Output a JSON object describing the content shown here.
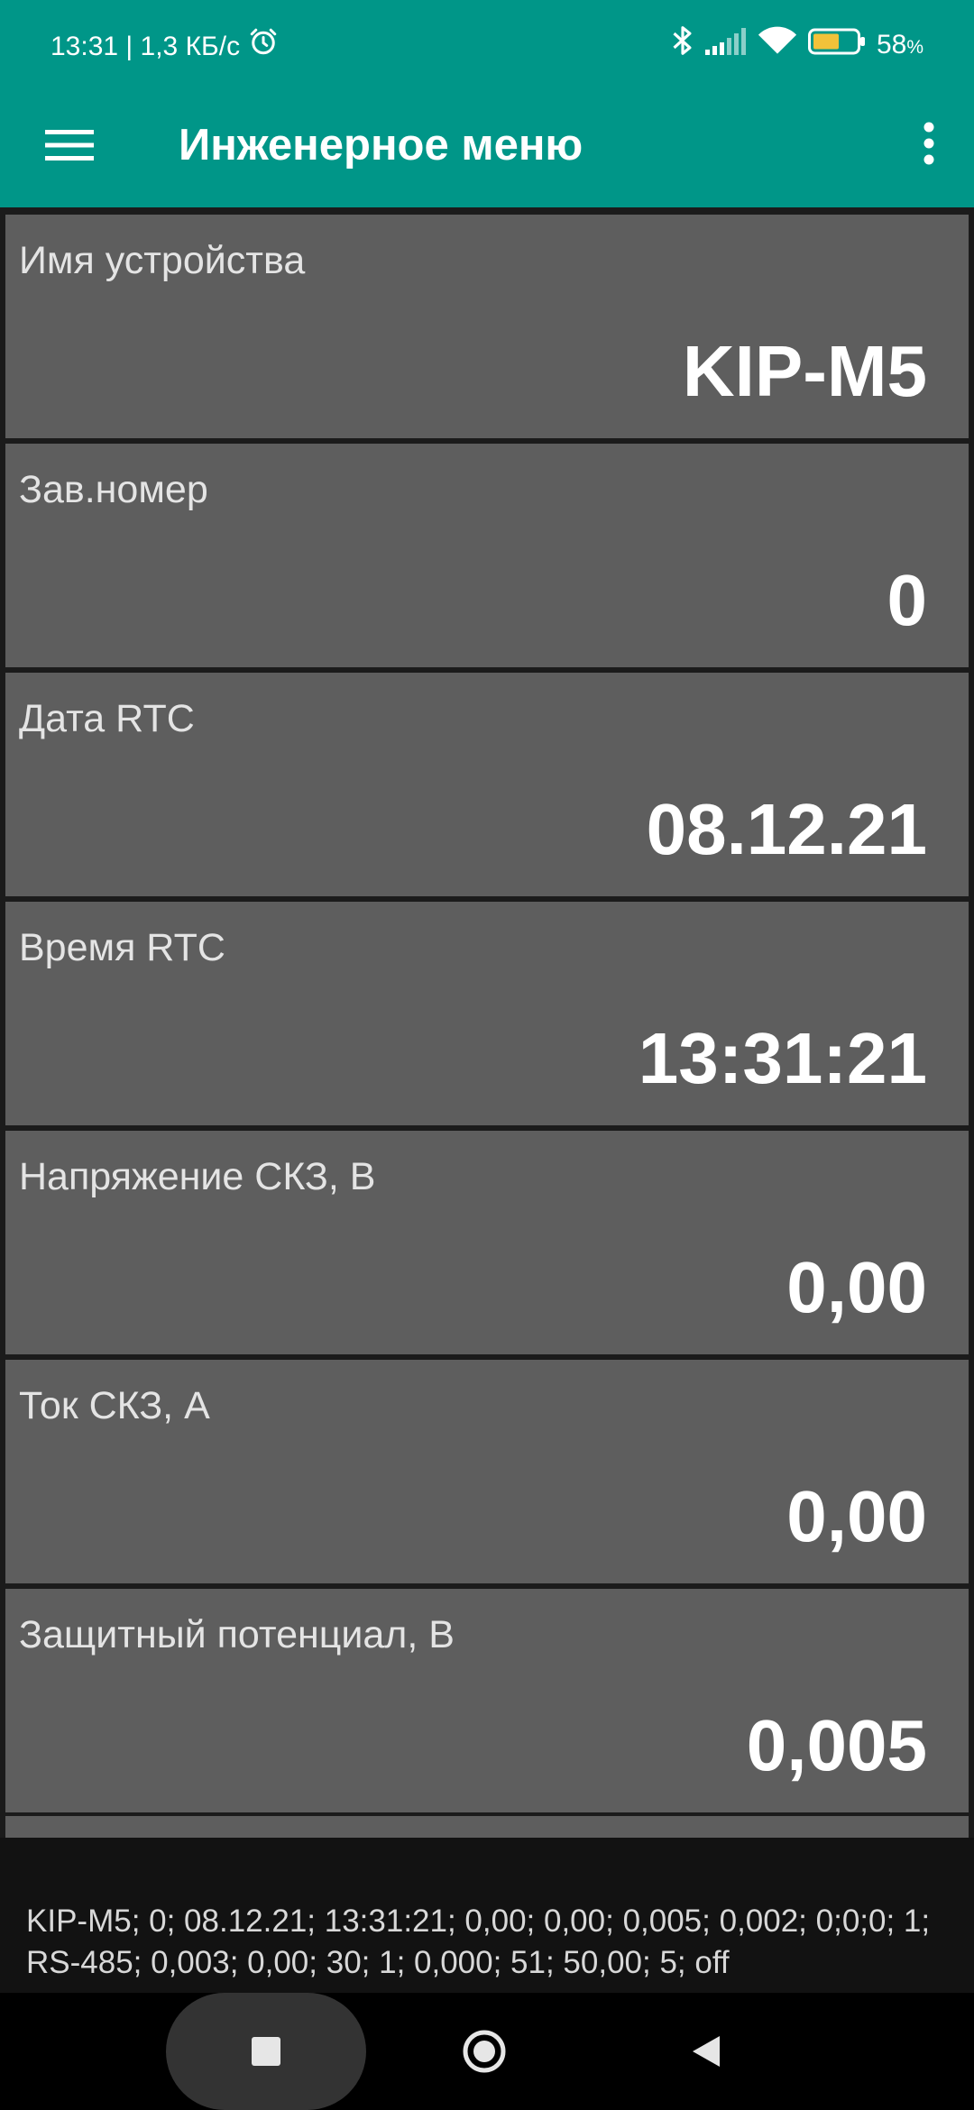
{
  "status_bar": {
    "time_speed": "13:31 | 1,3 КБ/с",
    "battery_percent": "58",
    "battery_sign": "%",
    "icons": [
      "alarm-icon",
      "bluetooth-icon",
      "signal-icon",
      "wifi-icon",
      "battery-icon"
    ]
  },
  "app_bar": {
    "title": "Инженерное меню",
    "menu_icon": "hamburger-menu-icon",
    "overflow_icon": "more-vert-icon",
    "background": "#009688"
  },
  "items": [
    {
      "label": "Имя устройства",
      "value": "KIP-M5"
    },
    {
      "label": "Зав.номер",
      "value": "0"
    },
    {
      "label": "Дата RTC",
      "value": "08.12.21"
    },
    {
      "label": "Время RTC",
      "value": "13:31:21"
    },
    {
      "label": "Напряжение СКЗ, В",
      "value": "0,00"
    },
    {
      "label": "Ток СКЗ, А",
      "value": "0,00"
    },
    {
      "label": "Защитный потенциал, В",
      "value": "0,005"
    }
  ],
  "summary": {
    "text": "KIP-M5; 0; 08.12.21; 13:31:21; 0,00; 0,00; 0,005; 0,002; 0;0;0; 1; RS-485; 0,003; 0,00; 30; 1; 0,000; 51; 50,00; 5; off"
  },
  "nav_bar": {
    "icons": [
      "recents-icon",
      "home-icon",
      "back-icon"
    ]
  },
  "colors": {
    "accent": "#009688",
    "item_background": "#5e5e5e",
    "list_background": "#1b1b1b",
    "text_primary": "#ffffff"
  }
}
